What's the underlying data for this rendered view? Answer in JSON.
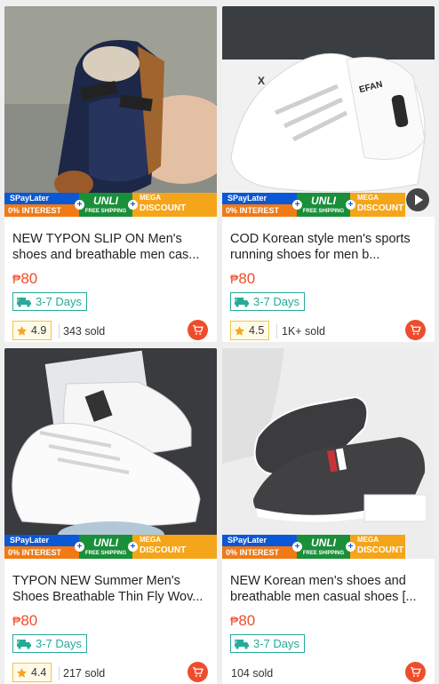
{
  "promo": {
    "spaylater": "SPayLater",
    "interest": "0% INTEREST",
    "unli": "UNLI",
    "free_shipping": "FREE SHIPPING",
    "mega": "MEGA",
    "discount": "DISCOUNT"
  },
  "colors": {
    "price": "#ee4d2d",
    "shipping": "#26aa99",
    "rating_border": "#f3c448",
    "cart": "#ee4d2d"
  },
  "products": [
    {
      "title": "NEW TYPON SLIP ON  Men's shoes and breathable men cas...",
      "currency": "₱",
      "price": "80",
      "shipping": "3-7 Days",
      "rating": "4.9",
      "sold": "343 sold",
      "has_video": false
    },
    {
      "title": "COD Korean style men's sports running shoes for men b...",
      "currency": "₱",
      "price": "80",
      "shipping": "3-7 Days",
      "rating": "4.5",
      "sold": "1K+ sold",
      "has_video": true
    },
    {
      "title": "TYPON NEW Summer Men's Shoes Breathable Thin Fly Wov...",
      "currency": "₱",
      "price": "80",
      "shipping": "3-7 Days",
      "rating": "4.4",
      "sold": "217 sold",
      "has_video": false
    },
    {
      "title": "NEW Korean men's  shoes and breathable men casual shoes  [...",
      "currency": "₱",
      "price": "80",
      "shipping": "3-7 Days",
      "rating": "",
      "sold": "104 sold",
      "has_video": false
    }
  ]
}
